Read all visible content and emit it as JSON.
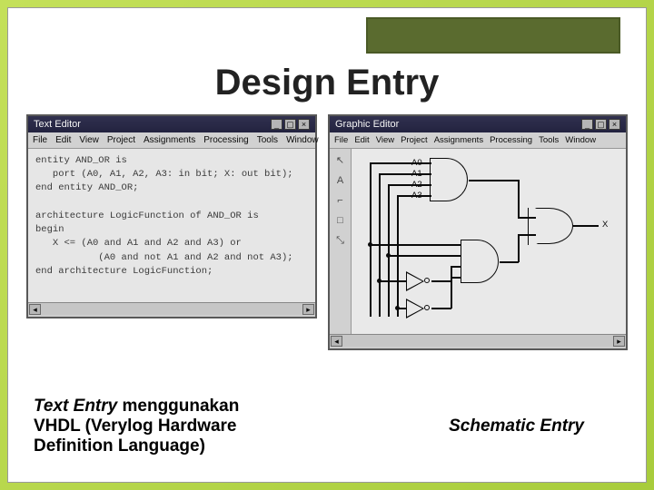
{
  "title": "Design Entry",
  "text_editor": {
    "window_title": "Text Editor",
    "menu": [
      "File",
      "Edit",
      "View",
      "Project",
      "Assignments",
      "Processing",
      "Tools",
      "Window"
    ],
    "code": "entity AND_OR is\n   port (A0, A1, A2, A3: in bit; X: out bit);\nend entity AND_OR;\n\narchitecture LogicFunction of AND_OR is\nbegin\n   X <= (A0 and A1 and A2 and A3) or\n           (A0 and not A1 and A2 and not A3);\nend architecture LogicFunction;"
  },
  "graphic_editor": {
    "window_title": "Graphic Editor",
    "menu": [
      "File",
      "Edit",
      "View",
      "Project",
      "Assignments",
      "Processing",
      "Tools",
      "Window"
    ],
    "tools": [
      "↖",
      "A",
      "⌐",
      "□",
      "⤡"
    ],
    "inputs": [
      "A0",
      "A1",
      "A2",
      "A3"
    ],
    "output": "X"
  },
  "captions": {
    "left_italic": "Text Entry",
    "left_rest": " menggunakan VHDL (Verylog Hardware Definition Language)",
    "right": "Schematic Entry"
  }
}
